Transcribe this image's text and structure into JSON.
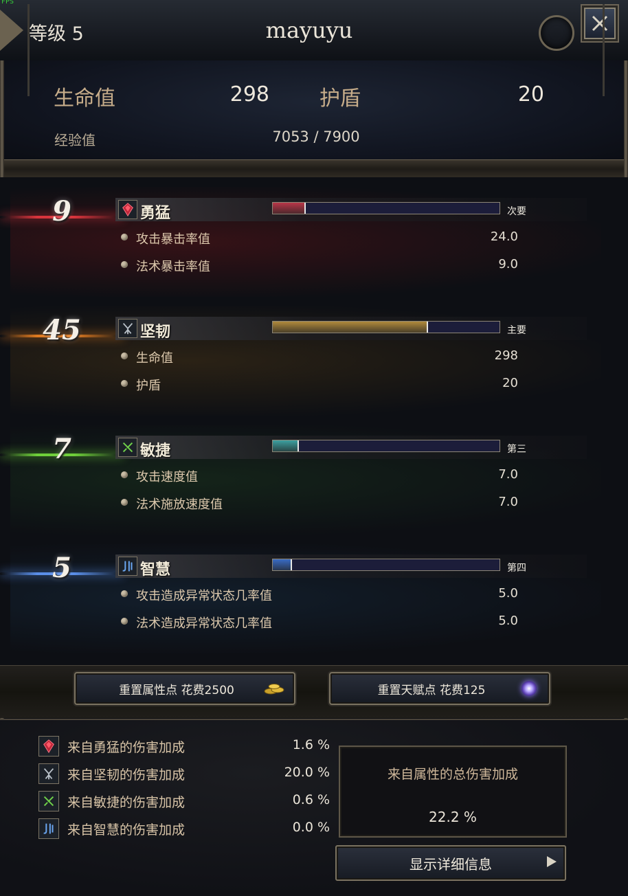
{
  "header": {
    "fps_label": "FPS",
    "level_label": "等级 5",
    "character_name": "mayuyu",
    "close_icon": "close-x-icon"
  },
  "stats": {
    "hp_label": "生命值",
    "hp_value": "298",
    "shield_label": "护盾",
    "shield_value": "20",
    "exp_label": "经验值",
    "exp_value": "7053  /  7900"
  },
  "attributes": [
    {
      "value": "9",
      "name": "勇猛",
      "icon": "valor-crystal-icon",
      "rank": "次要",
      "bar_fraction": 0.14,
      "accent": "#d8343c",
      "bar_color": "#b83648",
      "bg_tint": "#3a1216",
      "stats": [
        {
          "label": "攻击暴击率值",
          "value": "24.0"
        },
        {
          "label": "法术暴击率值",
          "value": "9.0"
        }
      ]
    },
    {
      "value": "45",
      "name": "坚韧",
      "icon": "toughness-rune-icon",
      "rank": "主要",
      "bar_fraction": 0.68,
      "accent": "#e07a20",
      "bar_color": "#b08a3c",
      "bg_tint": "#2e2415",
      "stats": [
        {
          "label": "生命值",
          "value": "298"
        },
        {
          "label": "护盾",
          "value": "20"
        }
      ]
    },
    {
      "value": "7",
      "name": "敏捷",
      "icon": "agility-rune-icon",
      "rank": "第三",
      "bar_fraction": 0.11,
      "accent": "#6fcf3a",
      "bar_color": "#3da0a0",
      "bg_tint": "#15261a",
      "stats": [
        {
          "label": "攻击速度值",
          "value": "7.0"
        },
        {
          "label": "法术施放速度值",
          "value": "7.0"
        }
      ]
    },
    {
      "value": "5",
      "name": "智慧",
      "icon": "wisdom-rune-icon",
      "rank": "第四",
      "bar_fraction": 0.08,
      "accent": "#5a8ee8",
      "bar_color": "#3a6cc4",
      "bg_tint": "#13202e",
      "stats": [
        {
          "label": "攻击造成异常状态几率值",
          "value": "5.0"
        },
        {
          "label": "法术造成异常状态几率值",
          "value": "5.0"
        }
      ]
    }
  ],
  "buttons": {
    "reset_attributes": "重置属性点 花费2500",
    "reset_attributes_icon": "gold-coins-icon",
    "reset_talents": "重置天赋点 花费125",
    "reset_talents_icon": "purple-orb-icon",
    "show_details": "显示详细信息",
    "show_details_icon": "play-arrow-icon"
  },
  "damage_bonus": {
    "rows": [
      {
        "label": "来自勇猛的伤害加成",
        "value": "1.6 %",
        "icon": "valor-crystal-icon"
      },
      {
        "label": "来自坚韧的伤害加成",
        "value": "20.0 %",
        "icon": "toughness-rune-icon"
      },
      {
        "label": "来自敏捷的伤害加成",
        "value": "0.6 %",
        "icon": "agility-rune-icon"
      },
      {
        "label": "来自智慧的伤害加成",
        "value": "0.0 %",
        "icon": "wisdom-rune-icon"
      }
    ],
    "total_label": "来自属性的总伤害加成",
    "total_value": "22.2 %"
  }
}
